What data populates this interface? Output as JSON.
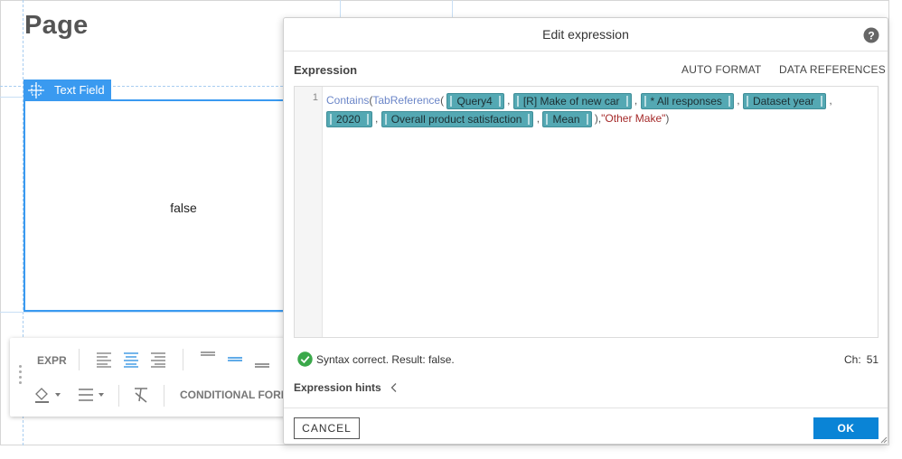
{
  "page": {
    "title": "Page"
  },
  "text_field": {
    "tag_label": "Text Field",
    "value": "false"
  },
  "toolbar": {
    "expr_label": "EXPR",
    "conditional_format_label": "CONDITIONAL FORM"
  },
  "dialog": {
    "title": "Edit expression",
    "expression_label": "Expression",
    "auto_format_label": "AUTO FORMAT",
    "data_references_label": "DATA REFERENCES",
    "line_number": "1",
    "code": {
      "fn_contains": "Contains",
      "fn_tabref": "TabReference",
      "chip_query": "Query4",
      "chip_make": "[R] Make of new car",
      "chip_responses": "* All responses",
      "chip_dataset_year": "Dataset year",
      "chip_2020": "2020",
      "chip_satisfaction": "Overall product satisfaction",
      "chip_mean": "Mean",
      "string_literal": "\"Other Make\""
    },
    "status_text": "Syntax correct. Result: false.",
    "ch_label": "Ch:",
    "ch_value": "51",
    "hints_label": "Expression hints",
    "cancel_label": "CANCEL",
    "ok_label": "OK"
  },
  "colors": {
    "accent": "#3a9af0",
    "primary_button": "#0a84d6",
    "chip": "#54a8b3",
    "success": "#3aa84a"
  }
}
